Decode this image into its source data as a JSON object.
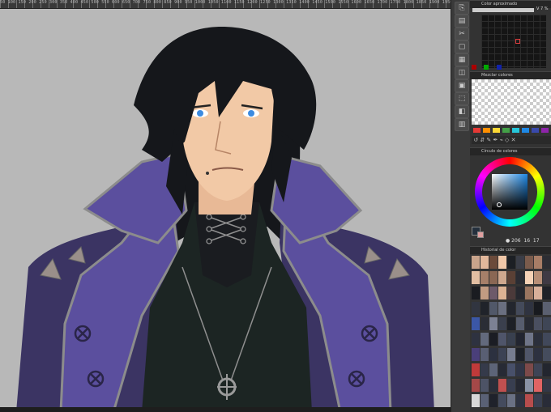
{
  "ruler": {
    "numbers": "50  100  150  200  250  300  350  400  450  500  550  600  650  700  750  800  850  900  950  1000  1050  1100  1150  1200  1250  1300  1350  1400  1450  1500  1550  1600  1650  1700  1750  1800  1850  1900  1950  2000  2050  2100"
  },
  "panels": {
    "approx": {
      "title": "Color aproximado",
      "v_label": "V",
      "v_value": "7 %"
    },
    "mixer": {
      "title": "Mezclar colores"
    },
    "wheel": {
      "title": "Círculo de colores",
      "h": "206",
      "s": "16",
      "v": "17"
    },
    "history": {
      "title": "Historial de color"
    }
  },
  "palette_colors": [
    "#e53935",
    "#ff8f00",
    "#fdd835",
    "#43a047",
    "#26c6da",
    "#1e88e5",
    "#3949ab",
    "#8e24aa"
  ],
  "accent": {
    "coat_purple": "#5b4f9e",
    "coat_dark": "#3b3463",
    "hair": "#15171b",
    "skin": "#f2c9a6",
    "canvas": "#b8b8b8"
  },
  "history_colors": [
    "#c9a48b",
    "#e1b79b",
    "#6b4a3a",
    "#f0c7a8",
    "#1c1f24",
    "#3a3d47",
    "#7a5b4c",
    "#a87d66",
    "#2c2d33",
    "#e2bea2",
    "#a67f69",
    "#8a6754",
    "#cfa88e",
    "#5a4035",
    "#2a2c33",
    "#f5d2b6",
    "#b88f77",
    "#3f3a44",
    "#1a1c21",
    "#c19b82",
    "#6d5a6a",
    "#dcb293",
    "#4b3a3a",
    "#26282f",
    "#9a7560",
    "#d8b09a",
    "#1f2128",
    "#313540",
    "#20232a",
    "#515869",
    "#6a6f80",
    "#23262e",
    "#444a5a",
    "#2f3340",
    "#181a1f",
    "#5b6070",
    "#3b57a6",
    "#2a2d36",
    "#7c8194",
    "#3a3f4d",
    "#1d2027",
    "#575d6e",
    "#282b34",
    "#4a4f60",
    "#3f4656",
    "#2e3240",
    "#636a7c",
    "#1b1d24",
    "#4f556a",
    "#39404f",
    "#222530",
    "#6f7588",
    "#2b2f3b",
    "#41485a",
    "#4a3f7a",
    "#595f73",
    "#2c3140",
    "#3c4254",
    "#777d90",
    "#1e2129",
    "#505669",
    "#2d3140",
    "#454c5d",
    "#c03a3a",
    "#353a4a",
    "#5d6478",
    "#272a35",
    "#48506a",
    "#303547",
    "#7d4a4a",
    "#3e4456",
    "#23262f",
    "#a54848",
    "#4d5366",
    "#2a2e3a",
    "#c05050",
    "#383e50",
    "#252832",
    "#8a93a6",
    "#e06464",
    "#323847",
    "#d7d7d7",
    "#5a6175",
    "#1f222b",
    "#444b5e",
    "#6a7184",
    "#2e3342",
    "#b74d4d",
    "#3a4052",
    "#292c38"
  ]
}
